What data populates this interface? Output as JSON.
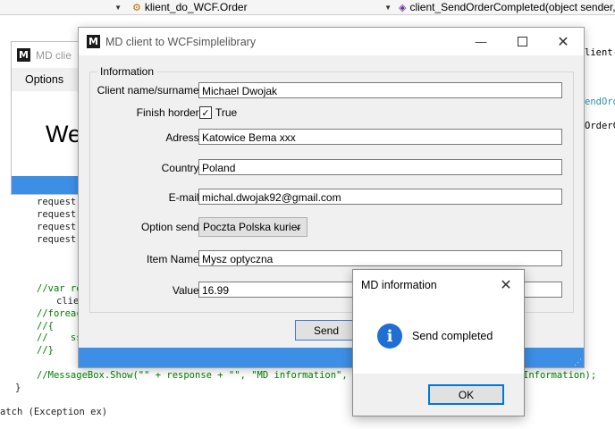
{
  "editor": {
    "combo_member": "klient_do_WCF.Order",
    "combo_method": "client_SendOrderCompleted(object sender,",
    "right_fragments": [
      "lient(e",
      "endOrde",
      "OrderCo"
    ],
    "code_lines": [
      "request.",
      "request.",
      "request.",
      "request.",
      "//var re",
      "clie",
      "//foreac",
      "//{",
      "//    ss",
      "//}",
      "//MessageBox.Show(\"\" + response + \"\", \"MD information\", Mess",
      "Information);",
      "}",
      "atch (Exception ex)"
    ]
  },
  "back_window": {
    "title": "MD clie",
    "menu_options": "Options",
    "big_text": "We"
  },
  "main_window": {
    "title": "MD client to WCFsimplelibrary",
    "group_title": "Information",
    "fields": {
      "name_label": "Client name/surname:",
      "name_value": "Michael Dwojak",
      "finish_label": "Finish horder:",
      "finish_value": "True",
      "address_label": "Adress:",
      "address_value": "Katowice Bema xxx",
      "country_label": "Country:",
      "country_value": "Poland",
      "email_label": "E-mail:",
      "email_value": "michal.dwojak92@gmail.com",
      "option_label": "Option send:",
      "option_value": "Poczta Polska kurier",
      "item_label": "Item Name:",
      "item_value": "Mysz optyczna",
      "value_label": "Value:",
      "value_value": "16.99"
    },
    "send_button": "Send"
  },
  "dialog": {
    "title": "MD information",
    "message": "Send completed",
    "ok_button": "OK"
  },
  "colors": {
    "accent_blue": "#3d8fe6",
    "info_blue": "#1e6fd1"
  },
  "icons": {
    "app_logo": "md-logo-icon",
    "info": "info-icon",
    "close": "close-icon",
    "minimize": "minimize-icon",
    "maximize": "maximize-icon",
    "dropdown": "chevron-down-icon",
    "checkmark": "checkmark-icon"
  }
}
